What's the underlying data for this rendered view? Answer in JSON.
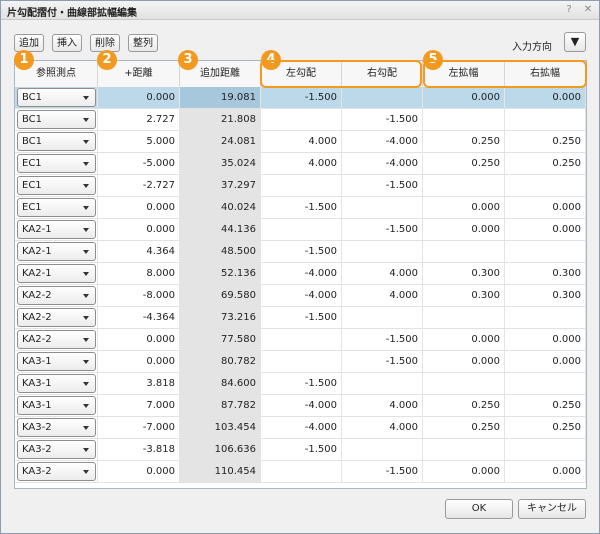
{
  "window": {
    "title": "片勾配摺付・曲線部拡幅編集",
    "help_glyph": "?",
    "close_glyph": "✕"
  },
  "toolbar": {
    "add": "追加",
    "insert": "挿入",
    "delete": "削除",
    "sort": "整列",
    "direction_label": "入力方向",
    "direction_glyph": "▼"
  },
  "grid": {
    "headers": [
      "参照測点",
      "+距離",
      "追加距離",
      "左勾配",
      "右勾配",
      "左拡幅",
      "右拡幅"
    ],
    "rows": [
      [
        "BC1",
        "0.000",
        "19.081",
        "-1.500",
        "",
        "0.000",
        "0.000"
      ],
      [
        "BC1",
        "2.727",
        "21.808",
        "",
        "-1.500",
        "",
        ""
      ],
      [
        "BC1",
        "5.000",
        "24.081",
        "4.000",
        "-4.000",
        "0.250",
        "0.250"
      ],
      [
        "EC1",
        "-5.000",
        "35.024",
        "4.000",
        "-4.000",
        "0.250",
        "0.250"
      ],
      [
        "EC1",
        "-2.727",
        "37.297",
        "",
        "-1.500",
        "",
        ""
      ],
      [
        "EC1",
        "0.000",
        "40.024",
        "-1.500",
        "",
        "0.000",
        "0.000"
      ],
      [
        "KA2-1",
        "0.000",
        "44.136",
        "",
        "-1.500",
        "0.000",
        "0.000"
      ],
      [
        "KA2-1",
        "4.364",
        "48.500",
        "-1.500",
        "",
        "",
        ""
      ],
      [
        "KA2-1",
        "8.000",
        "52.136",
        "-4.000",
        "4.000",
        "0.300",
        "0.300"
      ],
      [
        "KA2-2",
        "-8.000",
        "69.580",
        "-4.000",
        "4.000",
        "0.300",
        "0.300"
      ],
      [
        "KA2-2",
        "-4.364",
        "73.216",
        "-1.500",
        "",
        "",
        ""
      ],
      [
        "KA2-2",
        "0.000",
        "77.580",
        "",
        "-1.500",
        "0.000",
        "0.000"
      ],
      [
        "KA3-1",
        "0.000",
        "80.782",
        "",
        "-1.500",
        "0.000",
        "0.000"
      ],
      [
        "KA3-1",
        "3.818",
        "84.600",
        "-1.500",
        "",
        "",
        ""
      ],
      [
        "KA3-1",
        "7.000",
        "87.782",
        "-4.000",
        "4.000",
        "0.250",
        "0.250"
      ],
      [
        "KA3-2",
        "-7.000",
        "103.454",
        "-4.000",
        "4.000",
        "0.250",
        "0.250"
      ],
      [
        "KA3-2",
        "-3.818",
        "106.636",
        "-1.500",
        "",
        "",
        ""
      ],
      [
        "KA3-2",
        "0.000",
        "110.454",
        "",
        "-1.500",
        "0.000",
        "0.000"
      ]
    ]
  },
  "callouts": [
    "1",
    "2",
    "3",
    "4",
    "5"
  ],
  "footer": {
    "ok": "OK",
    "cancel": "キャンセル"
  },
  "colors": {
    "callout": "#f29a1f",
    "selected_row": "#bcd9ea"
  }
}
